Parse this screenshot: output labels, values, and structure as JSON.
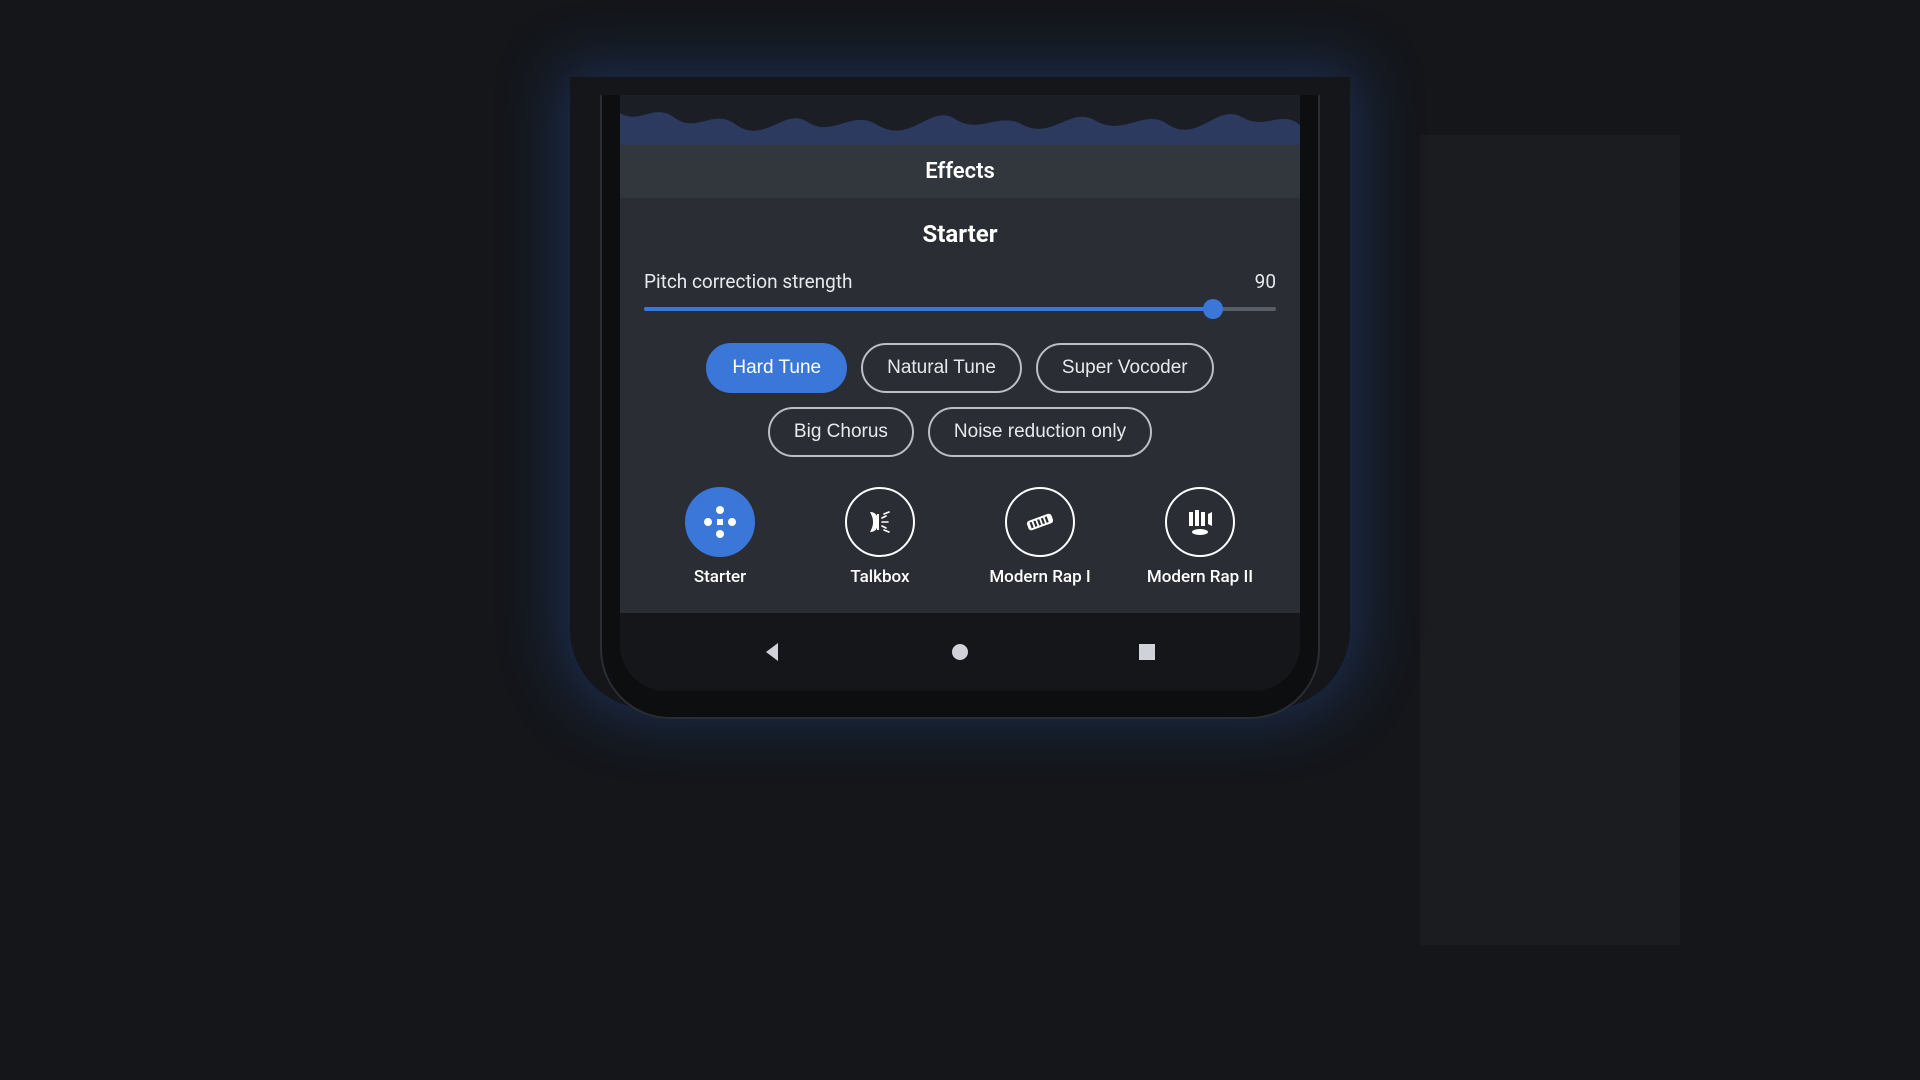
{
  "panel": {
    "header": "Effects",
    "preset_title": "Starter"
  },
  "slider": {
    "label": "Pitch correction strength",
    "value": "90",
    "percent": 90
  },
  "chips": [
    {
      "label": "Hard Tune",
      "active": true
    },
    {
      "label": "Natural Tune",
      "active": false
    },
    {
      "label": "Super Vocoder",
      "active": false
    },
    {
      "label": "Big Chorus",
      "active": false
    },
    {
      "label": "Noise reduction only",
      "active": false
    }
  ],
  "presets": [
    {
      "label": "Starter",
      "icon": "dpad-icon",
      "active": true
    },
    {
      "label": "Talkbox",
      "icon": "talkbox-icon",
      "active": false
    },
    {
      "label": "Modern Rap I",
      "icon": "keytar-icon",
      "active": false
    },
    {
      "label": "Modern Rap II",
      "icon": "bars-icon",
      "active": false
    }
  ],
  "colors": {
    "accent": "#3a77d9",
    "panel": "#2a2d33",
    "panel_header": "#32363d"
  }
}
